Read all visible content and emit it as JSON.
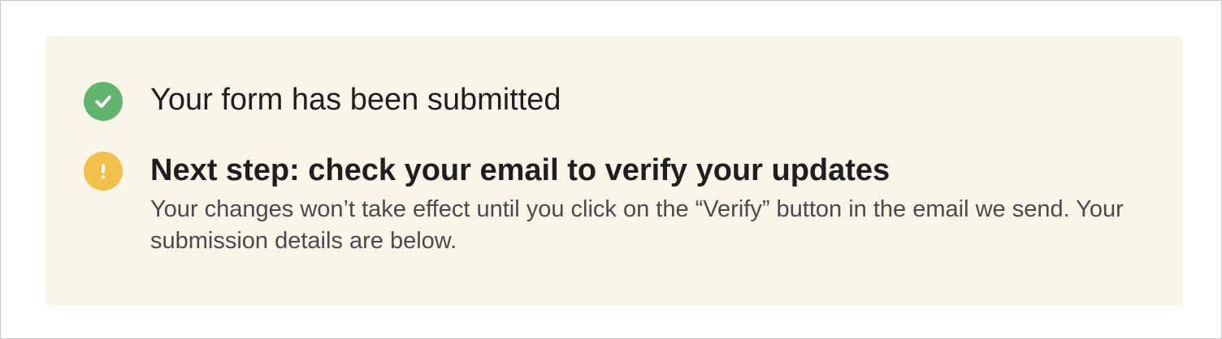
{
  "notice": {
    "success": {
      "icon": "check-circle-icon",
      "title": "Your form has been submitted"
    },
    "next_step": {
      "icon": "exclamation-circle-icon",
      "title": "Next step: check your email to verify your updates",
      "description": "Your changes won’t take effect until you click on the “Verify” button in the email we send. Your submission details are below."
    },
    "colors": {
      "background": "#f9f5e8",
      "success": "#63b56e",
      "warning": "#f2c14b"
    }
  }
}
